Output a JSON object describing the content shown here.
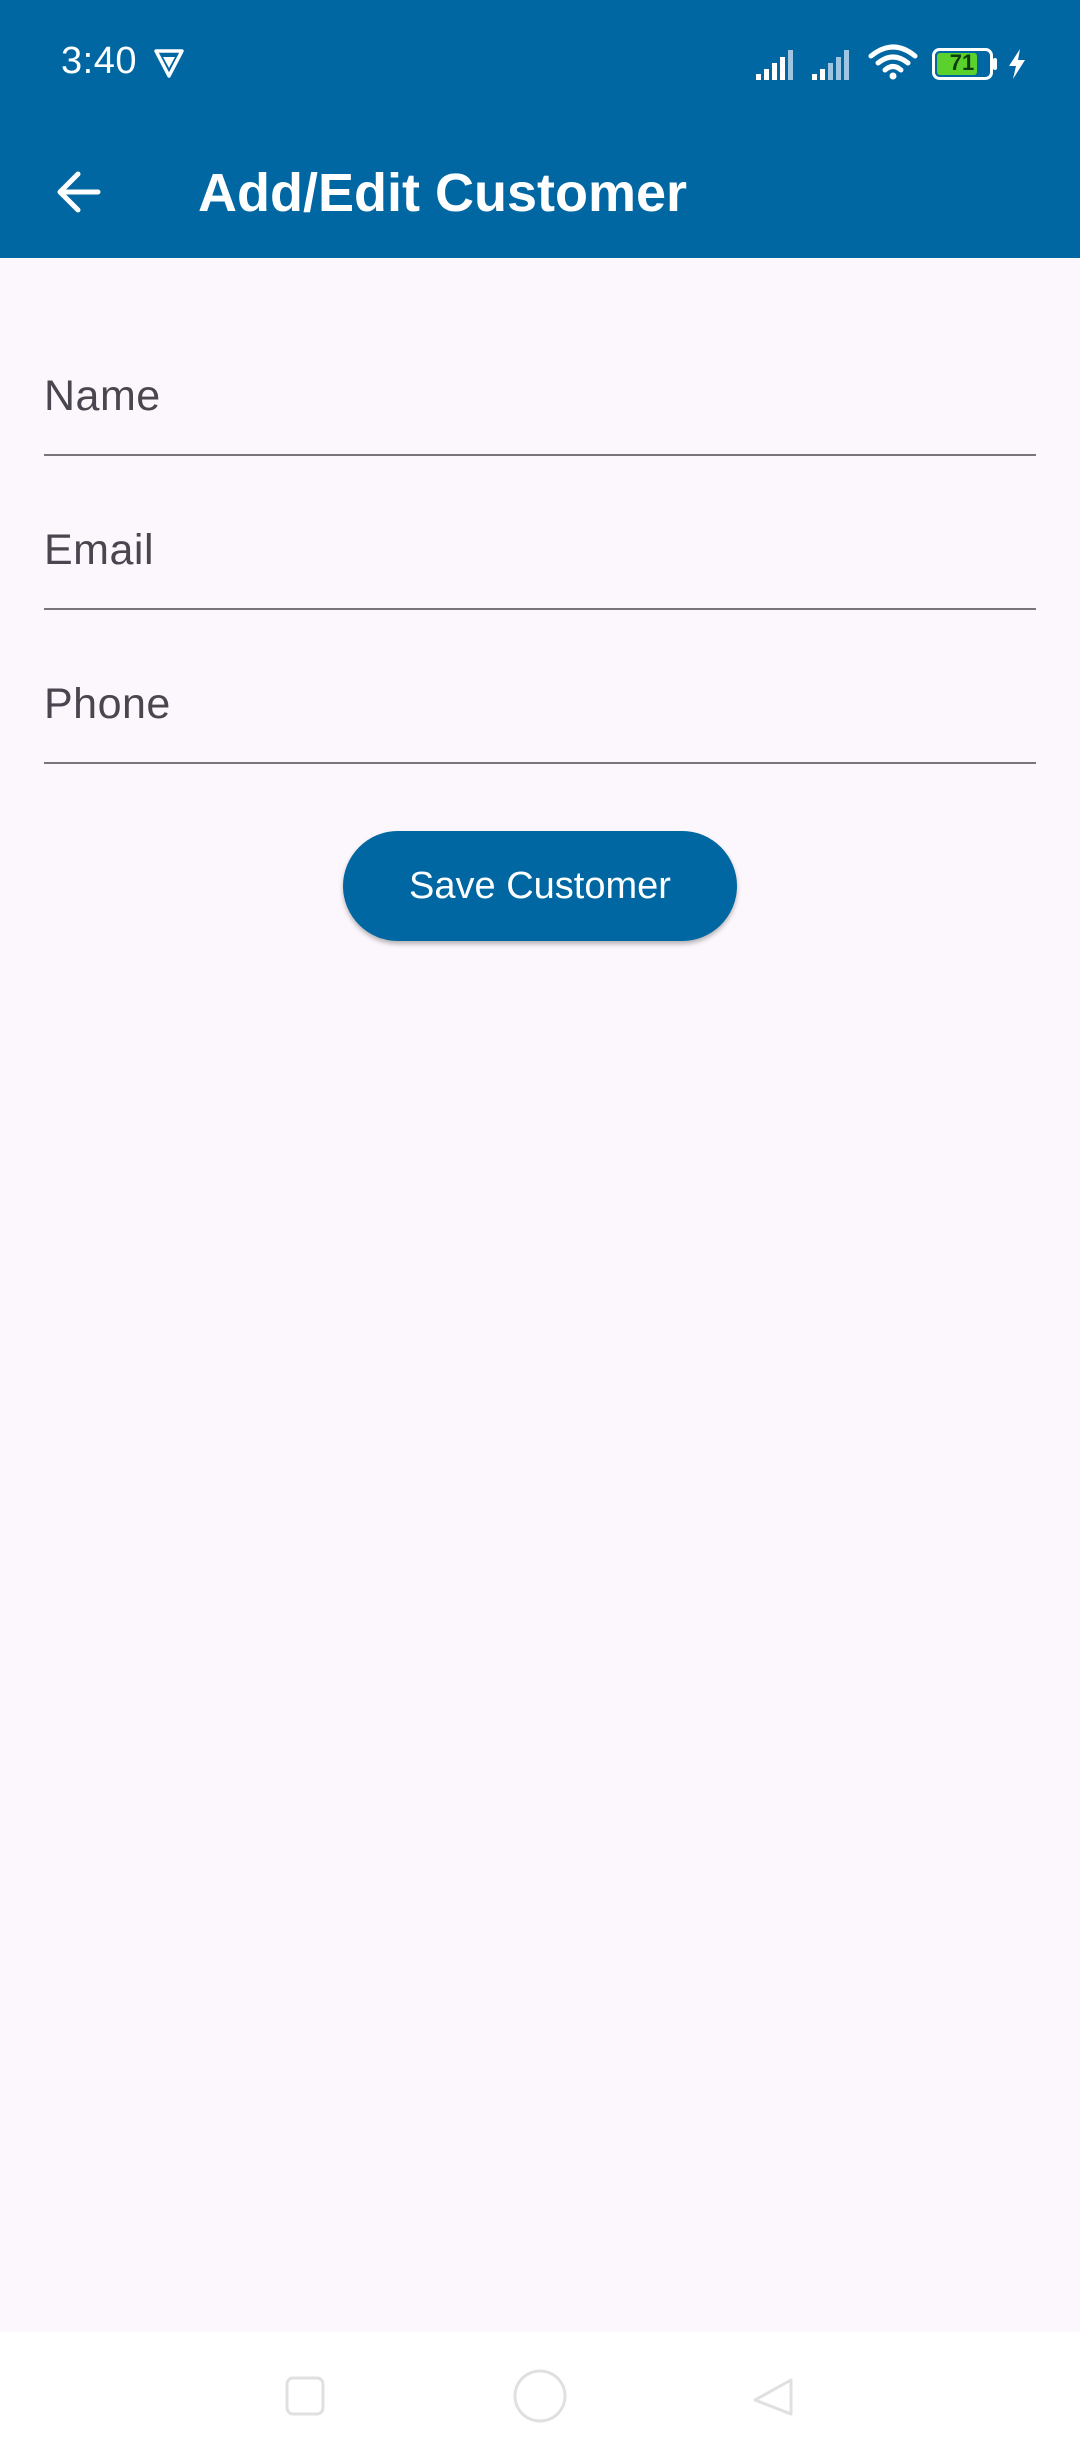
{
  "status_bar": {
    "time": "3:40",
    "battery_level": "71",
    "icons": [
      "vpn-icon",
      "cell-signal-icon",
      "cell-signal-icon",
      "wifi-icon",
      "battery-icon",
      "charging-icon"
    ]
  },
  "app_bar": {
    "title": "Add/Edit Customer",
    "back_icon": "arrow-back-icon"
  },
  "form": {
    "name": {
      "value": "",
      "placeholder": "Name"
    },
    "email": {
      "value": "",
      "placeholder": "Email"
    },
    "phone": {
      "value": "",
      "placeholder": "Phone"
    },
    "save_label": "Save Customer"
  },
  "nav_bar": {
    "icons": [
      "recents-icon",
      "home-icon",
      "back-icon"
    ]
  },
  "colors": {
    "primary": "#0067a3",
    "background": "#fcf7fc",
    "on_primary": "#ffffff",
    "battery_fill": "#5bd12e"
  }
}
